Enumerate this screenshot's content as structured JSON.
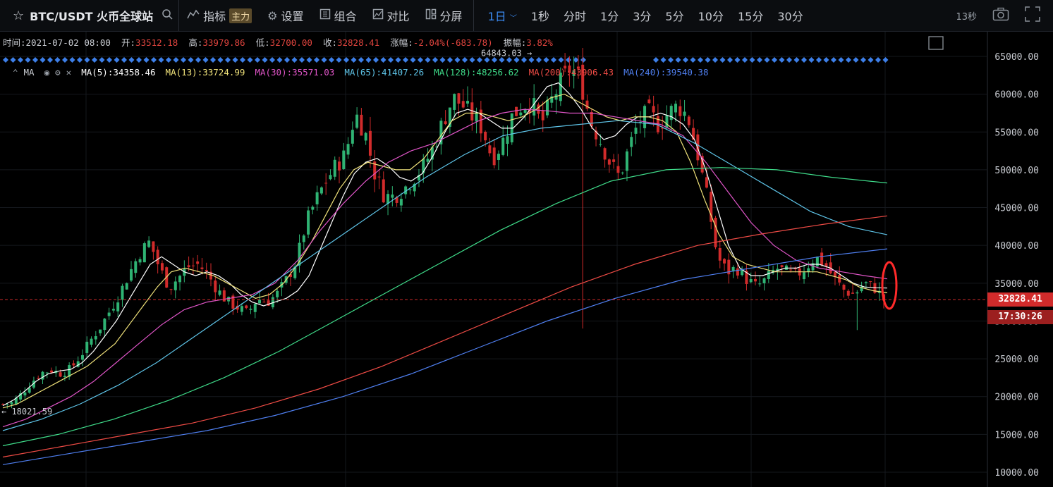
{
  "toolbar": {
    "symbol": "BTC/USDT 火币全球站",
    "indicator_label": "指标",
    "indicator_badge": "主力",
    "settings_label": "设置",
    "combo_label": "组合",
    "compare_label": "对比",
    "split_label": "分屏",
    "intervals": [
      "1日",
      "1秒",
      "分时",
      "1分",
      "3分",
      "5分",
      "10分",
      "15分",
      "30分"
    ],
    "active_interval": "1日",
    "countdown": "13秒",
    "icons": [
      "star-icon",
      "search-icon",
      "indicator-icon",
      "gear-icon",
      "combo-icon",
      "compare-icon",
      "split-icon",
      "camera-icon",
      "fullscreen-icon"
    ]
  },
  "ohlc": {
    "time_label": "时间:",
    "time": "2021-07-02 08:00",
    "open_label": "开:",
    "open": "33512.18",
    "high_label": "高:",
    "high": "33979.86",
    "low_label": "低:",
    "low": "32700.00",
    "close_label": "收:",
    "close": "32828.41",
    "change_label": "涨幅:",
    "change": "-2.04%(-683.78)",
    "amplitude_label": "振幅:",
    "amplitude": "3.82%"
  },
  "ma_legend": {
    "title": "MA",
    "items": [
      {
        "label": "MA(5):34358.46",
        "color": "#ffffff"
      },
      {
        "label": "MA(13):33724.99",
        "color": "#f0e27a"
      },
      {
        "label": "MA(30):35571.03",
        "color": "#e055c8"
      },
      {
        "label": "MA(65):41407.26",
        "color": "#5ec4e8"
      },
      {
        "label": "MA(128):48256.62",
        "color": "#3fdc8a"
      },
      {
        "label": "MA(200):43906.43",
        "color": "#ee4b45"
      },
      {
        "label": "MA(240):39540.38",
        "color": "#4f7ff0"
      }
    ]
  },
  "chart_data": {
    "type": "candlestick",
    "y_ticks": [
      "65000.00",
      "60000.00",
      "55000.00",
      "50000.00",
      "45000.00",
      "40000.00",
      "35000.00",
      "30000.00",
      "25000.00",
      "20000.00",
      "15000.00",
      "10000.00"
    ],
    "ylim": [
      8500,
      67000
    ],
    "last_price": "32828.41",
    "last_price_value": 32828.41,
    "countdown_tag": "17:30:26",
    "high_marker": "64843.03",
    "high_marker_value": 64843.03,
    "low_marker": "18021.59",
    "low_marker_value": 18021.59,
    "close_path": [
      19000,
      19200,
      20500,
      22000,
      23200,
      23500,
      23000,
      23800,
      25500,
      27500,
      29300,
      31500,
      33800,
      36500,
      39000,
      40500,
      37000,
      34500,
      35800,
      37200,
      37500,
      36000,
      34000,
      32500,
      31800,
      31000,
      33000,
      32500,
      33500,
      35500,
      38000,
      43000,
      46000,
      48500,
      50500,
      52000,
      57500,
      55000,
      49500,
      46500,
      46500,
      47500,
      49000,
      50500,
      53000,
      56500,
      59500,
      58500,
      57000,
      55500,
      51500,
      53500,
      57000,
      58500,
      59000,
      56000,
      59000,
      61500,
      63500,
      62000,
      56500,
      54000,
      51000,
      49000,
      53000,
      56500,
      57500,
      56000,
      57500,
      58500,
      57000,
      52000,
      46000,
      38500,
      36500,
      37000,
      35500,
      34500,
      35500,
      37000,
      36500,
      36000,
      37000,
      38500,
      37500,
      35500,
      34000,
      33500,
      35000,
      34500,
      32828
    ],
    "ma": {
      "ma5": [
        18800,
        19600,
        20800,
        22100,
        23000,
        23400,
        23600,
        24500,
        26000,
        28000,
        30000,
        32500,
        35000,
        37500,
        38500,
        37500,
        36500,
        36000,
        36500,
        36000,
        35000,
        33500,
        32500,
        32000,
        32500,
        33000,
        34000,
        36000,
        39500,
        43000,
        46500,
        49500,
        51000,
        51500,
        50500,
        49000,
        48500,
        49500,
        52000,
        55000,
        57500,
        58000,
        57500,
        56500,
        55500,
        55500,
        57000,
        59000,
        61000,
        61500,
        60000,
        58000,
        55500,
        54000,
        54500,
        56000,
        57000,
        57000,
        57500,
        57000,
        56000,
        54000,
        50000,
        45000,
        40000,
        37000,
        36000,
        36000,
        36500,
        37000,
        37000,
        37500,
        37500,
        37000,
        36000,
        35000,
        34500,
        34400,
        34358
      ],
      "ma13": [
        18500,
        19000,
        20000,
        21000,
        22000,
        23000,
        24000,
        25500,
        27000,
        29500,
        32000,
        34500,
        36500,
        37000,
        36500,
        36000,
        35000,
        34000,
        33000,
        33500,
        35000,
        37500,
        40500,
        44000,
        47500,
        50000,
        51000,
        50500,
        50000,
        50000,
        51500,
        54000,
        56500,
        57500,
        57500,
        57000,
        56500,
        57000,
        58000,
        59500,
        60000,
        59000,
        58000,
        57000,
        56500,
        57000,
        57000,
        56500,
        55000,
        51000,
        46000,
        41500,
        38500,
        37500,
        37000,
        36500,
        36500,
        36500,
        36500,
        36000,
        35500,
        34500,
        34000,
        33725
      ],
      "ma30": [
        16000,
        17000,
        18500,
        20000,
        22000,
        24500,
        27000,
        29500,
        31500,
        32500,
        33000,
        33500,
        35000,
        38000,
        42000,
        45500,
        48500,
        51000,
        52500,
        53500,
        55000,
        56500,
        57500,
        58000,
        57800,
        57500,
        57500,
        57000,
        56500,
        56000,
        54500,
        51000,
        47000,
        43000,
        40000,
        38000,
        37000,
        36500,
        36000,
        35571
      ],
      "ma65": [
        15500,
        17000,
        19000,
        21500,
        24500,
        28000,
        31500,
        35000,
        38500,
        42000,
        45500,
        49000,
        52000,
        54500,
        55500,
        56000,
        56500,
        56000,
        53500,
        50500,
        47500,
        44500,
        42500,
        41407
      ],
      "ma128": [
        13500,
        15000,
        17000,
        19500,
        22500,
        26000,
        30000,
        34000,
        38000,
        42000,
        45500,
        48500,
        50000,
        50300,
        50000,
        49000,
        48256
      ],
      "ma200": [
        12000,
        13500,
        15000,
        16500,
        18500,
        21000,
        24000,
        27500,
        31000,
        34500,
        37500,
        40000,
        41500,
        42800,
        43906
      ],
      "ma240": [
        11000,
        12500,
        14000,
        15500,
        17500,
        20000,
        23000,
        26500,
        30000,
        33000,
        35500,
        37000,
        38500,
        39540
      ]
    }
  }
}
